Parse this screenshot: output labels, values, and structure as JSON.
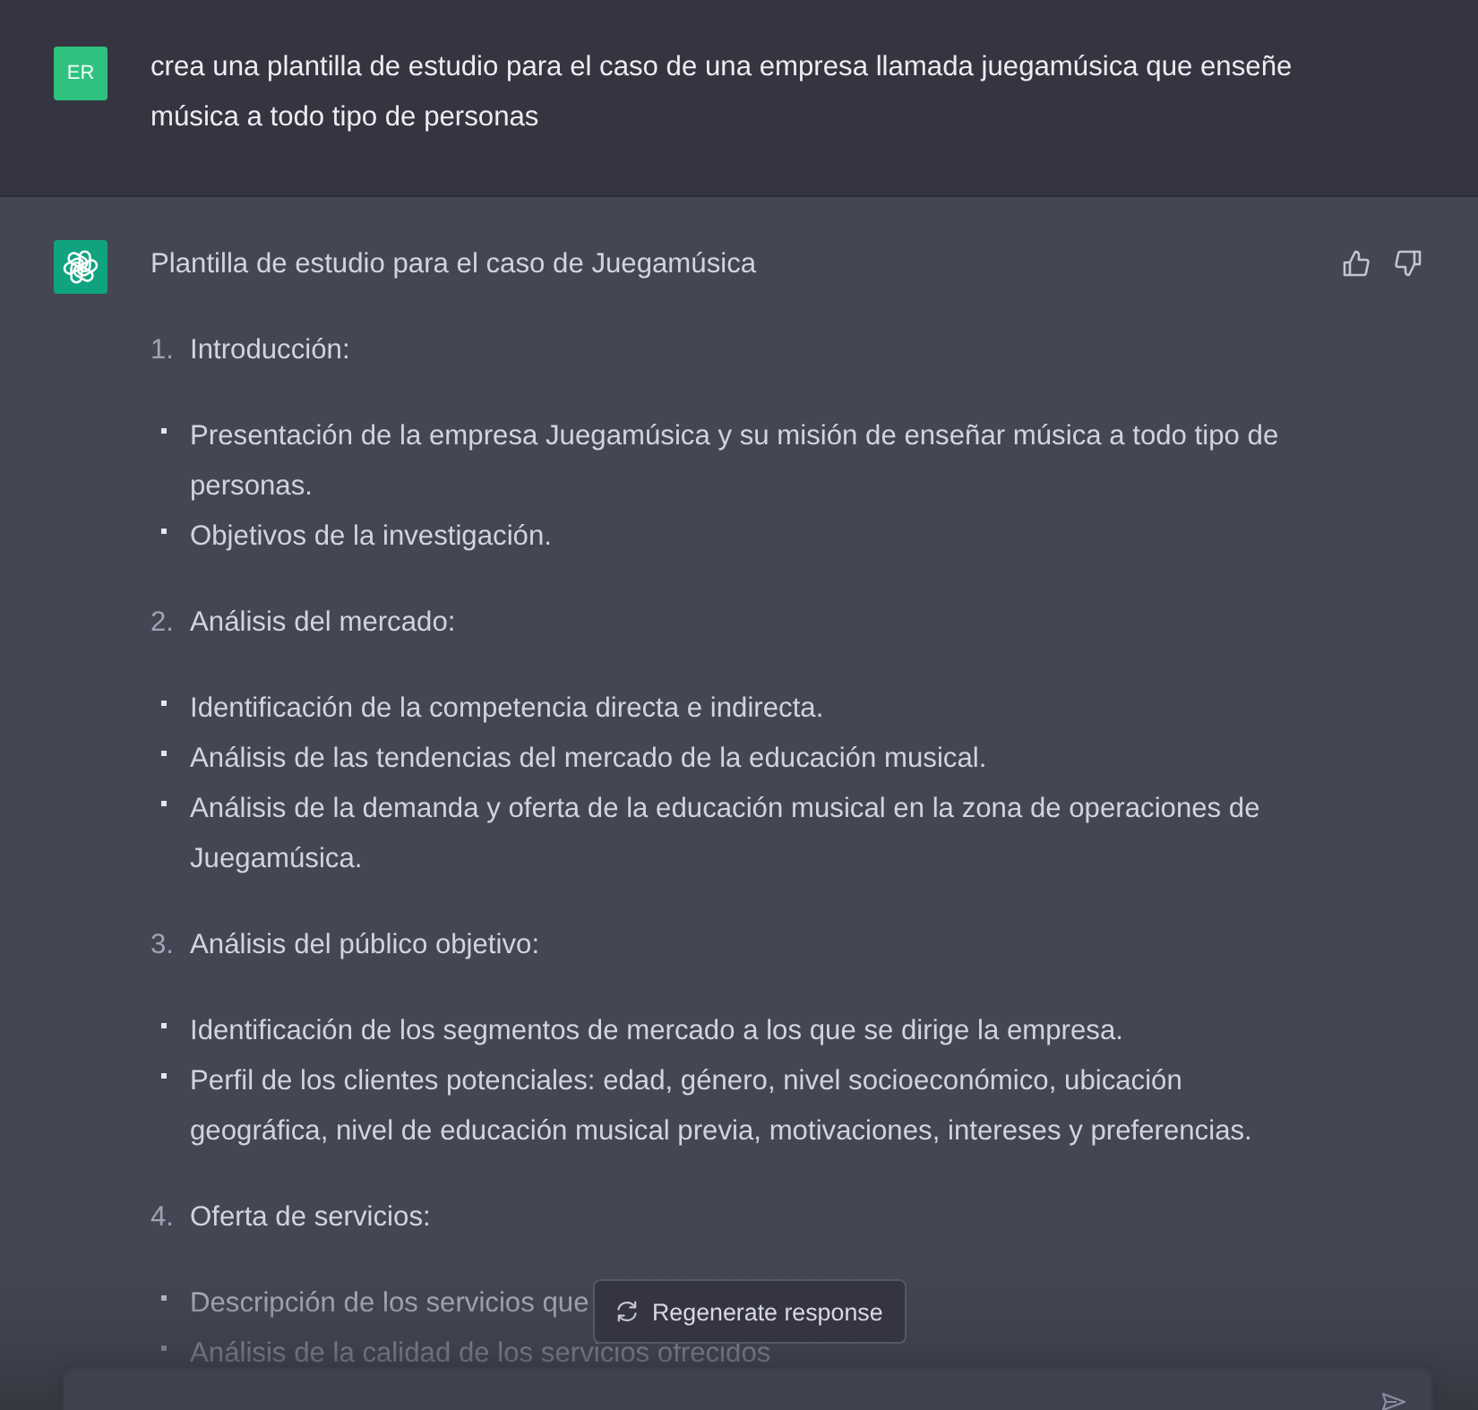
{
  "user_message": {
    "avatar": "ER",
    "text": "crea una plantilla de estudio para el caso de una empresa llamada juegamúsica que enseñe música a todo tipo de personas"
  },
  "assistant_message": {
    "title": "Plantilla de estudio para el caso de Juegamúsica",
    "sections": [
      {
        "number": "1.",
        "heading": "Introducción:",
        "bullets": [
          "Presentación de la empresa Juegamúsica y su misión de enseñar música a todo tipo de personas.",
          "Objetivos de la investigación."
        ]
      },
      {
        "number": "2.",
        "heading": "Análisis del mercado:",
        "bullets": [
          "Identificación de la competencia directa e indirecta.",
          "Análisis de las tendencias del mercado de la educación musical.",
          "Análisis de la demanda y oferta de la educación musical en la zona de operaciones de Juegamúsica."
        ]
      },
      {
        "number": "3.",
        "heading": "Análisis del público objetivo:",
        "bullets": [
          "Identificación de los segmentos de mercado a los que se dirige la empresa.",
          "Perfil de los clientes potenciales: edad, género, nivel socioeconómico, ubicación geográfica, nivel de educación musical previa, motivaciones, intereses y preferencias."
        ]
      },
      {
        "number": "4.",
        "heading": "Oferta de servicios:",
        "bullets": [
          "Descripción de los servicios que",
          "Análisis de la calidad de los servicios ofrecidos"
        ]
      }
    ]
  },
  "regenerate_button": {
    "label": "Regenerate response"
  }
}
